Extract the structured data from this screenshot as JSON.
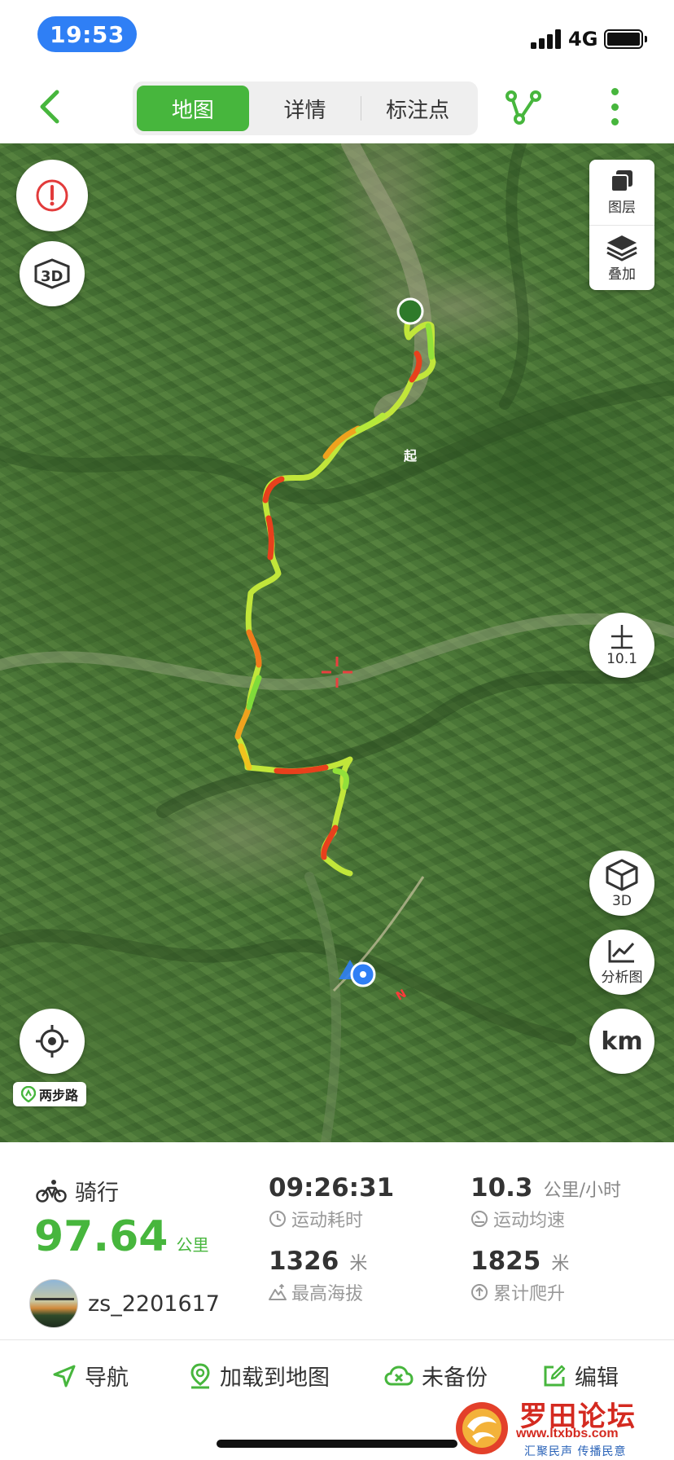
{
  "status_bar": {
    "time": "19:53",
    "network": "4G"
  },
  "nav": {
    "tabs": [
      {
        "label": "地图",
        "active": true
      },
      {
        "label": "详情",
        "active": false
      },
      {
        "label": "标注点",
        "active": false
      }
    ]
  },
  "map": {
    "layers_label": "图层",
    "overlay_label": "叠加",
    "zoom_level": "10.1",
    "view3d_label": "3D",
    "analysis_label": "分析图",
    "unit_label": "km",
    "start_marker": "起",
    "brand_badge": "两步路"
  },
  "summary": {
    "sport": "骑行",
    "distance": "97.64",
    "distance_unit": "公里",
    "username": "zs_2201617",
    "stats": {
      "duration": {
        "value": "09:26:31",
        "label": "运动耗时"
      },
      "avg_speed": {
        "value": "10.3",
        "unit": "公里/小时",
        "label": "运动均速"
      },
      "max_altitude": {
        "value": "1326",
        "unit": "米",
        "label": "最高海拔"
      },
      "total_climb": {
        "value": "1825",
        "unit": "米",
        "label": "累计爬升"
      }
    }
  },
  "actions": {
    "navigate": "导航",
    "load_to_map": "加载到地图",
    "backup": "未备份",
    "edit": "编辑"
  },
  "watermark": {
    "title": "罗田论坛",
    "url": "www.ltxbbs.com",
    "slogan": "汇聚民声 传播民意"
  },
  "colors": {
    "accent": "#47b63d",
    "status_pill": "#2f7ff5",
    "track_start": "#8ee23a",
    "track_hot": "#e8401c"
  }
}
